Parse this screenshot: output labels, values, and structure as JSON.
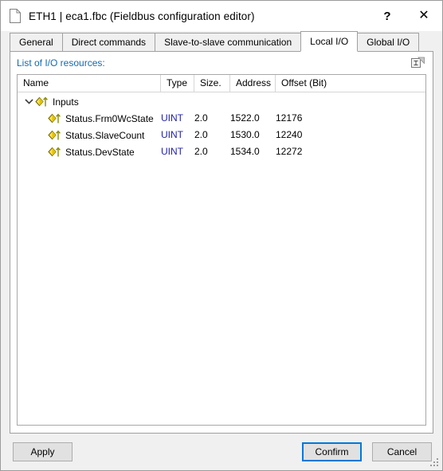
{
  "window": {
    "title": "ETH1 | eca1.fbc (Fieldbus configuration editor)",
    "doc_icon": "document-icon",
    "help_glyph": "?",
    "close_glyph": "✕"
  },
  "tabs": [
    {
      "label": "General",
      "active": false
    },
    {
      "label": "Direct commands",
      "active": false
    },
    {
      "label": "Slave-to-slave communication",
      "active": false
    },
    {
      "label": "Local I/O",
      "active": true
    },
    {
      "label": "Global I/O",
      "active": false
    }
  ],
  "panel": {
    "heading": "List of I/O resources:",
    "heading_color": "#1569b0",
    "export_icon": "export-document-icon"
  },
  "table": {
    "columns": [
      "Name",
      "Type",
      "Size.",
      "Address",
      "Offset (Bit)"
    ],
    "group": {
      "label": "Inputs",
      "expanded": true,
      "chevron_icon": "chevron-down-icon",
      "node_icon": "io-input-icon"
    },
    "rows": [
      {
        "name": "Status.Frm0WcState",
        "type": "UINT",
        "size": "2.0",
        "address": "1522.0",
        "offset": "12176",
        "icon": "io-input-icon"
      },
      {
        "name": "Status.SlaveCount",
        "type": "UINT",
        "size": "2.0",
        "address": "1530.0",
        "offset": "12240",
        "icon": "io-input-icon"
      },
      {
        "name": "Status.DevState",
        "type": "UINT",
        "size": "2.0",
        "address": "1534.0",
        "offset": "12272",
        "icon": "io-input-icon"
      }
    ],
    "type_color": "#2222aa"
  },
  "footer": {
    "apply_label": "Apply",
    "confirm_label": "Confirm",
    "cancel_label": "Cancel",
    "focus_color": "#0078d7"
  }
}
